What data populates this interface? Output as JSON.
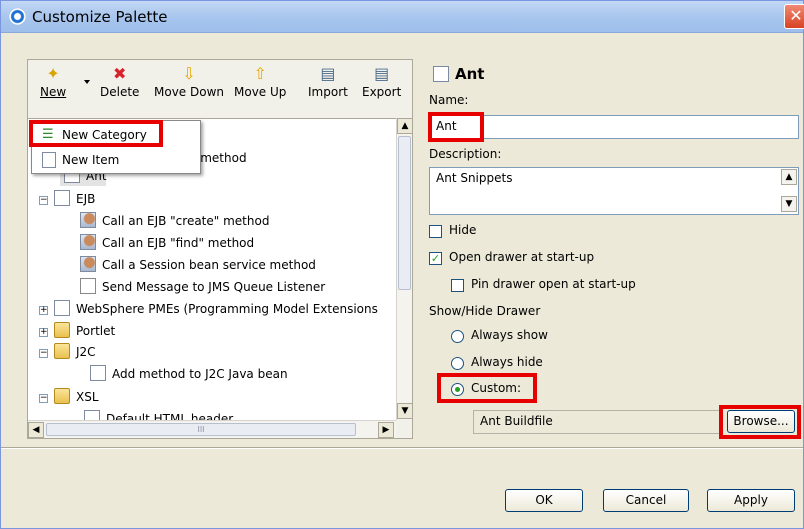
{
  "window": {
    "title": "Customize Palette",
    "close_glyph": "✕"
  },
  "toolbar": {
    "new": {
      "label": "New",
      "icon": "new-icon"
    },
    "delete": {
      "label": "Delete",
      "icon": "delete-icon"
    },
    "move_down": {
      "label": "Move Down",
      "icon": "move-down-icon"
    },
    "move_up": {
      "label": "Move Up",
      "icon": "move-up-icon"
    },
    "import": {
      "label": "Import",
      "icon": "import-icon"
    },
    "export": {
      "label": "Export",
      "icon": "export-icon"
    }
  },
  "new_menu": {
    "items": [
      {
        "label": "New Category",
        "icon": "category-icon",
        "highlighted": true
      },
      {
        "label": "New Item",
        "icon": "item-icon"
      }
    ]
  },
  "tree": {
    "partial_row": "vice method",
    "selected_row": "Ant",
    "ejb": {
      "label": "EJB",
      "children": [
        "Call an EJB \"create\" method",
        "Call an EJB \"find\" method",
        "Call a Session bean service method",
        "Send Message to JMS Queue Listener"
      ]
    },
    "websphere": "WebSphere PMEs (Programming Model Extensions",
    "portlet": "Portlet",
    "j2c": {
      "label": "J2C",
      "children": [
        "Add method to J2C Java bean"
      ]
    },
    "xsl": {
      "label": "XSL",
      "children": [
        "Default HTML header"
      ]
    },
    "hscroll_grip": "III"
  },
  "details": {
    "header": "Ant",
    "name_label": "Name:",
    "name_value": "Ant",
    "description_label": "Description:",
    "description_value": "Ant Snippets",
    "hide_label": "Hide",
    "hide_checked": false,
    "open_drawer_label": "Open drawer at start-up",
    "open_drawer_checked": true,
    "pin_drawer_label": "Pin drawer open at start-up",
    "pin_drawer_checked": false,
    "show_hide_label": "Show/Hide Drawer",
    "always_show_label": "Always show",
    "always_hide_label": "Always hide",
    "custom_label": "Custom:",
    "selected_option": "Custom",
    "custom_value": "Ant Buildfile",
    "browse_label": "Browse..."
  },
  "buttons": {
    "ok": "OK",
    "cancel": "Cancel",
    "apply": "Apply"
  },
  "colors": {
    "highlight_box": "#e60000",
    "title_bar": "#a9c6ee",
    "dialog_bg": "#ece9d8",
    "check_green": "#21a121"
  }
}
